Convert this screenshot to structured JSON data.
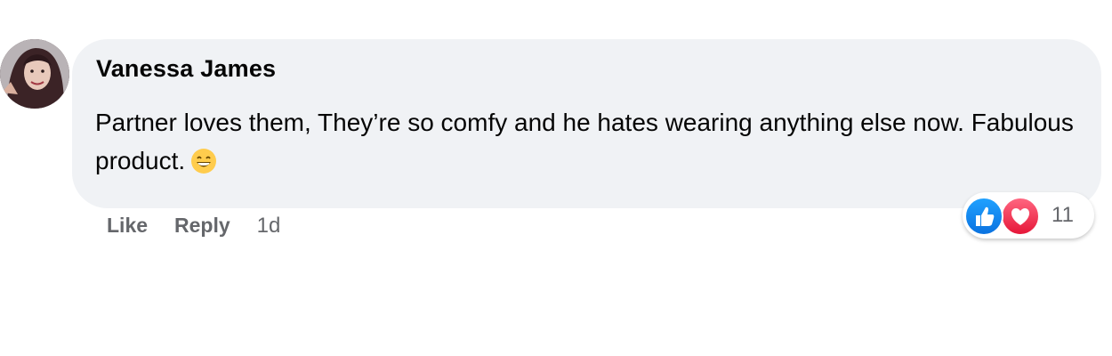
{
  "comment": {
    "author": "Vanessa James",
    "text": "Partner loves them, They’re so comfy and he hates wearing anything else now. Fabulous product.",
    "emoji": "grinning-face-emoji"
  },
  "actions": {
    "like_label": "Like",
    "reply_label": "Reply",
    "timestamp": "1d"
  },
  "reactions": {
    "icons": [
      "like-icon",
      "love-icon"
    ],
    "count": "11"
  },
  "colors": {
    "bubble": "#f0f2f5",
    "like": "#0a72e0",
    "love": "#e61739",
    "secondary_text": "#65676b"
  }
}
